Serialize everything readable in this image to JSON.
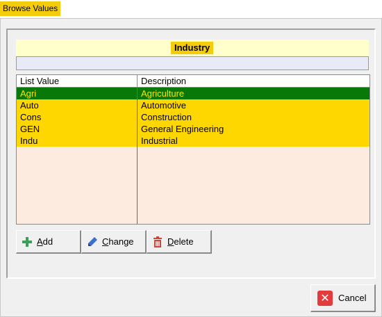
{
  "window": {
    "title": "Browse Values"
  },
  "section": {
    "title": "Industry"
  },
  "list": {
    "columns": [
      "List Value",
      "Description"
    ],
    "rows": [
      {
        "value": "Agri",
        "description": "Agriculture",
        "selected": true
      },
      {
        "value": "Auto",
        "description": "Automotive",
        "selected": false
      },
      {
        "value": "Cons",
        "description": "Construction",
        "selected": false
      },
      {
        "value": "GEN",
        "description": "General Engineering",
        "selected": false
      },
      {
        "value": "Indu",
        "description": "Industrial",
        "selected": false
      }
    ]
  },
  "buttons": {
    "add": "Add",
    "change": "Change",
    "delete": "Delete",
    "cancel": "Cancel"
  },
  "colors": {
    "accent_yellow": "#f4cc0c",
    "row_yellow": "#ffd700",
    "selected_green": "#087808",
    "empty_list_bg": "#fdebe0"
  }
}
